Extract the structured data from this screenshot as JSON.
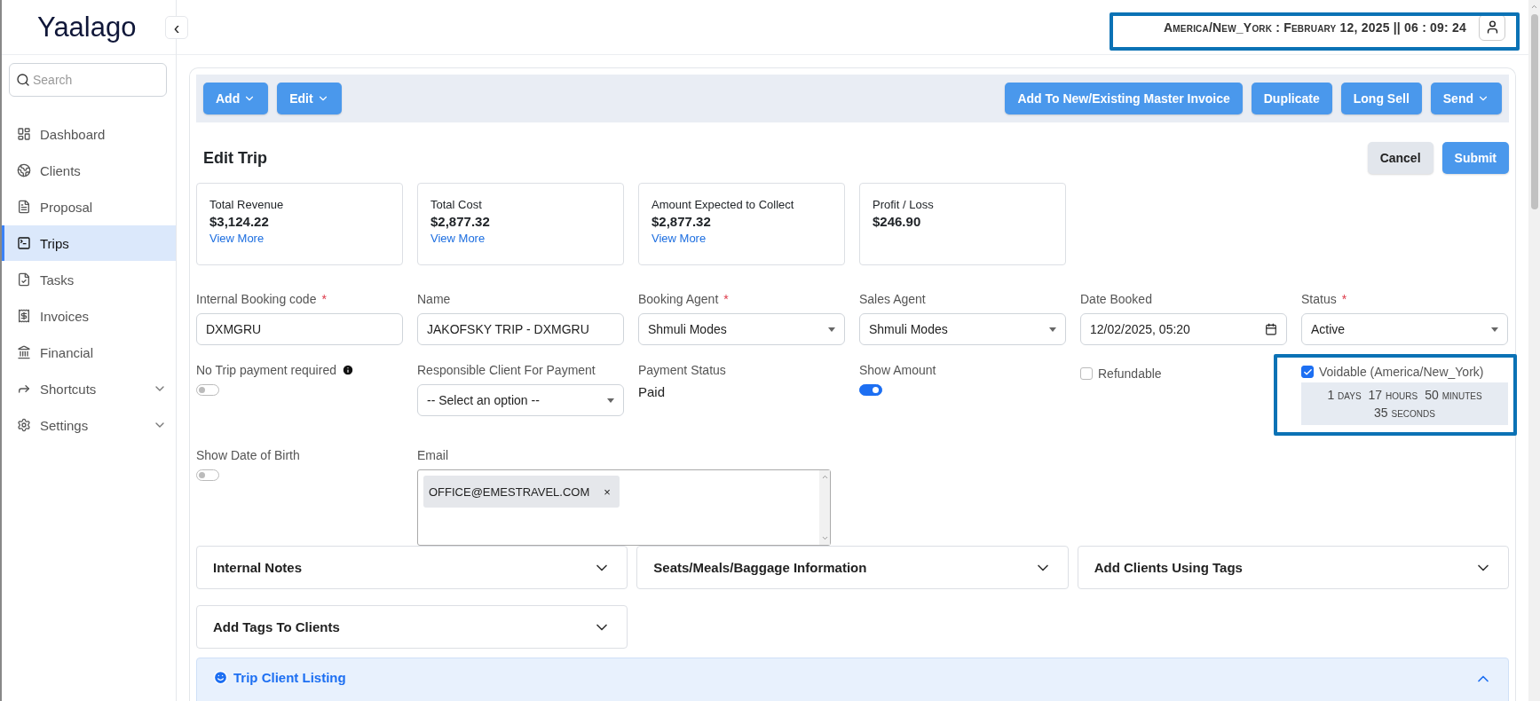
{
  "sidebar": {
    "logo": "Yaalago",
    "collapse": "‹",
    "search": {
      "placeholder": "Search"
    },
    "items": [
      {
        "label": "Dashboard",
        "selected": false,
        "expandable": false
      },
      {
        "label": "Clients",
        "selected": false,
        "expandable": false
      },
      {
        "label": "Proposal",
        "selected": false,
        "expandable": false
      },
      {
        "label": "Trips",
        "selected": true,
        "expandable": false
      },
      {
        "label": "Tasks",
        "selected": false,
        "expandable": false
      },
      {
        "label": "Invoices",
        "selected": false,
        "expandable": false
      },
      {
        "label": "Financial",
        "selected": false,
        "expandable": false
      },
      {
        "label": "Shortcuts",
        "selected": false,
        "expandable": true
      },
      {
        "label": "Settings",
        "selected": false,
        "expandable": true
      }
    ]
  },
  "header": {
    "clock": "America/New_York : February 12, 2025 || 06 : 09: 24",
    "highlighted": true
  },
  "toolbar": {
    "left": [
      {
        "label": "Add",
        "dropdown": true
      },
      {
        "label": "Edit",
        "dropdown": true
      }
    ],
    "right": [
      {
        "label": "Add To New/Existing Master Invoice",
        "dropdown": false
      },
      {
        "label": "Duplicate",
        "dropdown": false
      },
      {
        "label": "Long Sell",
        "dropdown": false
      },
      {
        "label": "Send",
        "dropdown": true
      }
    ]
  },
  "page_title": "Edit Trip",
  "actions": [
    {
      "label": "Cancel",
      "kind": "secondary"
    },
    {
      "label": "Submit",
      "kind": "primary"
    }
  ],
  "summary": [
    {
      "label": "Total Revenue",
      "value": "$3,124.22",
      "link": "View More"
    },
    {
      "label": "Total Cost",
      "value": "$2,877.32",
      "link": "View More"
    },
    {
      "label": "Amount Expected to Collect",
      "value": "$2,877.32",
      "link": "View More"
    },
    {
      "label": "Profit / Loss",
      "value": "$246.90"
    }
  ],
  "fields": [
    {
      "kind": "text",
      "label": "Internal Booking code",
      "required_mark": "*",
      "value": "DXMGRU"
    },
    {
      "kind": "text",
      "label": "Name",
      "value": "JAKOFSKY TRIP - DXMGRU"
    },
    {
      "kind": "select",
      "label": "Booking Agent",
      "required_mark": "*",
      "value": "Shmuli Modes"
    },
    {
      "kind": "select",
      "label": "Sales Agent",
      "value": "Shmuli Modes"
    },
    {
      "kind": "datetime",
      "label": "Date Booked",
      "value": "12/02/2025, 05:20"
    },
    {
      "kind": "select",
      "label": "Status",
      "required_mark": "*",
      "value": "Active"
    },
    {
      "kind": "toggle",
      "label": "No Trip payment required",
      "info": true,
      "on": false
    },
    {
      "kind": "select",
      "label": "Responsible Client For Payment",
      "value": "-- Select an option --"
    },
    {
      "kind": "status",
      "label": "Payment Status",
      "value": "Paid"
    },
    {
      "kind": "toggle",
      "label": "Show Amount",
      "on": true
    },
    {
      "kind": "checkbox",
      "label": "Refundable",
      "checked": false
    },
    {
      "kind": "voidable",
      "label": "Voidable (America/New_York)",
      "checked": true,
      "highlighted": true,
      "countdown": [
        {
          "value": "1",
          "unit": "days"
        },
        {
          "value": "17",
          "unit": "hours"
        },
        {
          "value": "50",
          "unit": "minutes"
        },
        {
          "value": "35",
          "unit": "seconds"
        }
      ]
    },
    {
      "kind": "toggle",
      "label": "Show Date of Birth",
      "on": false
    },
    {
      "kind": "email",
      "label": "Email",
      "tags": [
        {
          "text": "OFFICE@EMESTRAVEL.COM",
          "remove": "×"
        }
      ]
    }
  ],
  "accordions": [
    {
      "title": "Internal Notes",
      "expanded": false
    },
    {
      "title": "Seats/Meals/Baggage Information",
      "expanded": false
    },
    {
      "title": "Add Clients Using Tags",
      "expanded": false
    },
    {
      "title": "Add Tags To Clients",
      "expanded": false
    }
  ],
  "section": {
    "title": "Trip Client Listing",
    "expanded": true
  }
}
